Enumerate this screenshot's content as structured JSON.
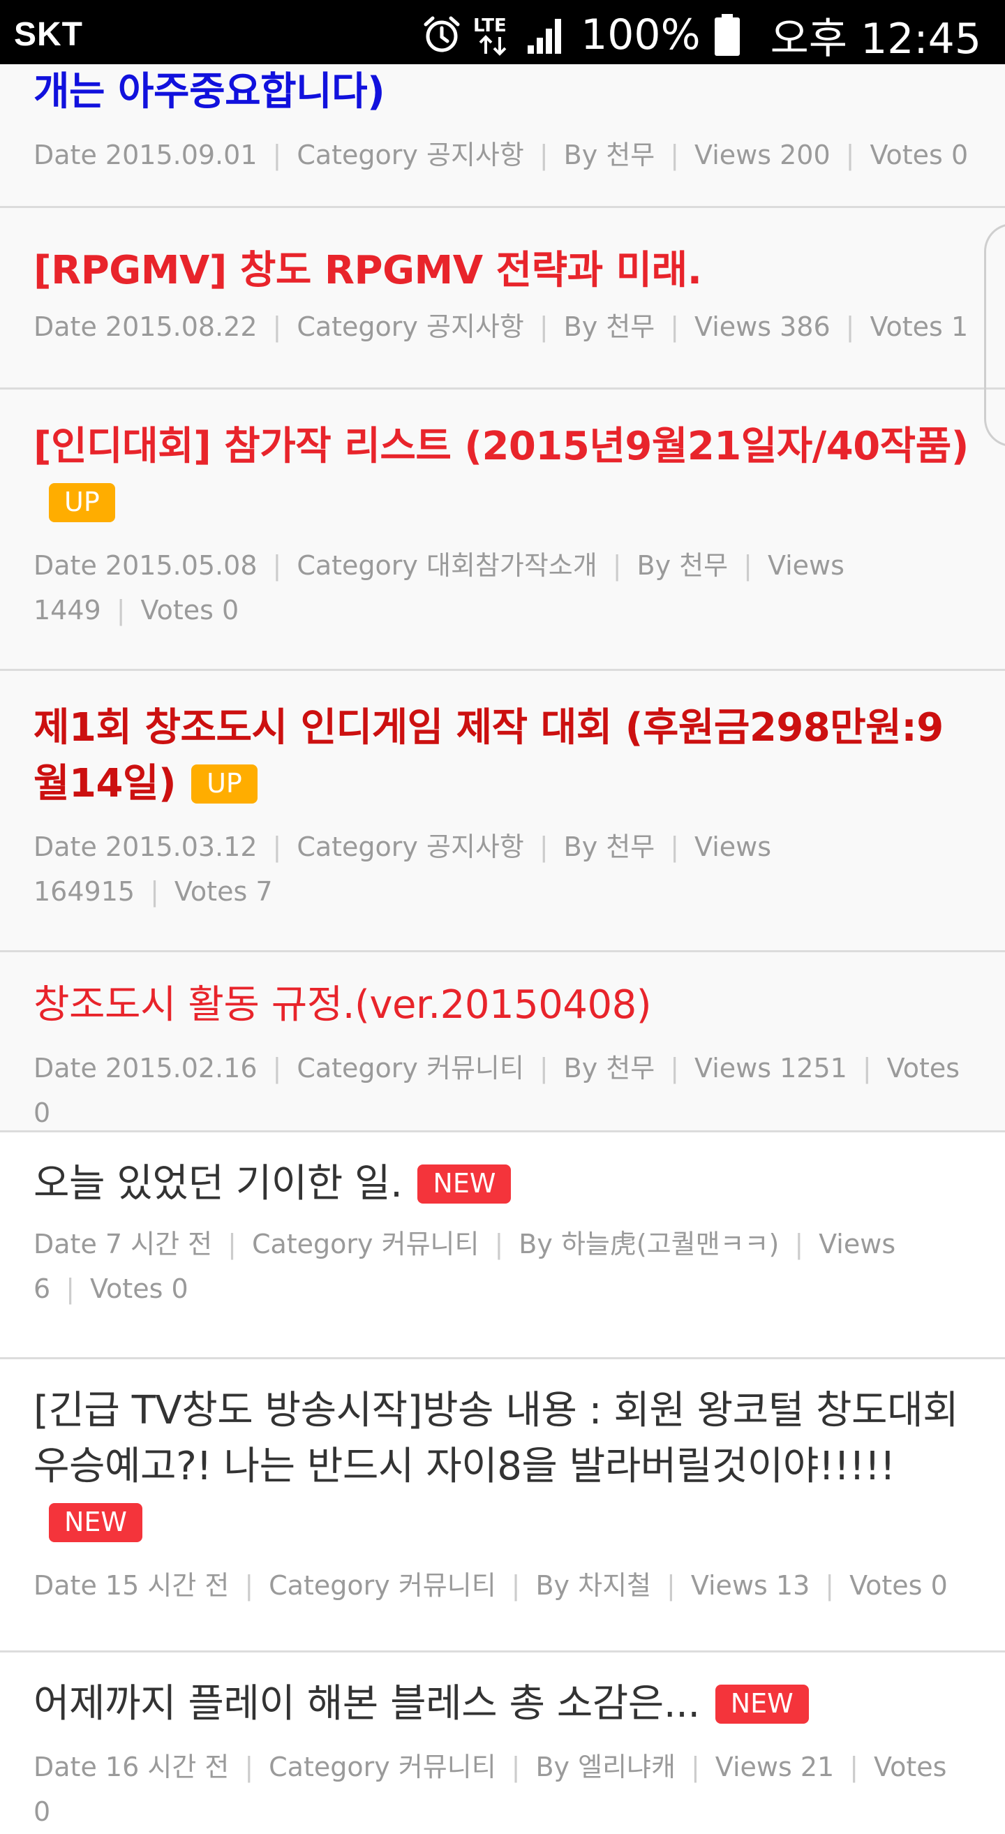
{
  "status_bar": {
    "carrier": "SKT",
    "network": "LTE",
    "battery": "100%",
    "time": "오후 12:45",
    "icons": [
      "alarm-icon",
      "lte-icon",
      "signal-icon",
      "battery-icon"
    ]
  },
  "meta_labels": {
    "date": "Date",
    "category": "Category",
    "by": "By",
    "views": "Views",
    "votes": "Votes"
  },
  "posts": [
    {
      "title": "개는 아주중요합니다)",
      "badge": "",
      "date": "2015.09.01",
      "category": "공지사항",
      "by": "천무",
      "views": "200",
      "votes": "0"
    },
    {
      "title": "[RPGMV] 창도 RPGMV 전략과 미래.",
      "badge": "",
      "date": "2015.08.22",
      "category": "공지사항",
      "by": "천무",
      "views": "386",
      "votes": "1"
    },
    {
      "title": "[인디대회] 참가작 리스트 (2015년9월21일자/40작품)",
      "badge": "UP",
      "date": "2015.05.08",
      "category": "대회참가작소개",
      "by": "천무",
      "views": "1449",
      "votes": "0"
    },
    {
      "title": "제1회 창조도시 인디게임 제작 대회 (후원금298만원:9월14일)",
      "badge": "UP",
      "date": "2015.03.12",
      "category": "공지사항",
      "by": "천무",
      "views": "164915",
      "votes": "7"
    },
    {
      "title": "창조도시 활동 규정.(ver.20150408)",
      "badge": "",
      "date": "2015.02.16",
      "category": "커뮤니티",
      "by": "천무",
      "views": "1251",
      "votes": "0"
    },
    {
      "title": "오늘 있었던 기이한 일.",
      "badge": "NEW",
      "date": "7 시간 전",
      "category": "커뮤니티",
      "by": "하늘虎(고퀄맨ㅋㅋ)",
      "views": "6",
      "votes": "0"
    },
    {
      "title": "[긴급 TV창도 방송시작]방송 내용 : 회원 왕코털 창도대회 우승예고?! 나는 반드시 자이8을 발라버릴것이야!!!!!",
      "badge": "NEW",
      "date": "15 시간 전",
      "category": "커뮤니티",
      "by": "차지철",
      "views": "13",
      "votes": "0"
    },
    {
      "title": "어제까지 플레이 해본 블레스 총 소감은...",
      "badge": "NEW",
      "date": "16 시간 전",
      "category": "커뮤니티",
      "by": "엘리냐캐",
      "views": "21",
      "votes": "0"
    }
  ],
  "colors": {
    "status_bar_bg": "#000000",
    "notice_title_red": "#e8242b",
    "notice_title_blue": "#1111dd",
    "badge_up": "#ffad00",
    "badge_new": "#f4343b",
    "meta_gray": "#9a9a9a",
    "normal_title": "#333333"
  }
}
